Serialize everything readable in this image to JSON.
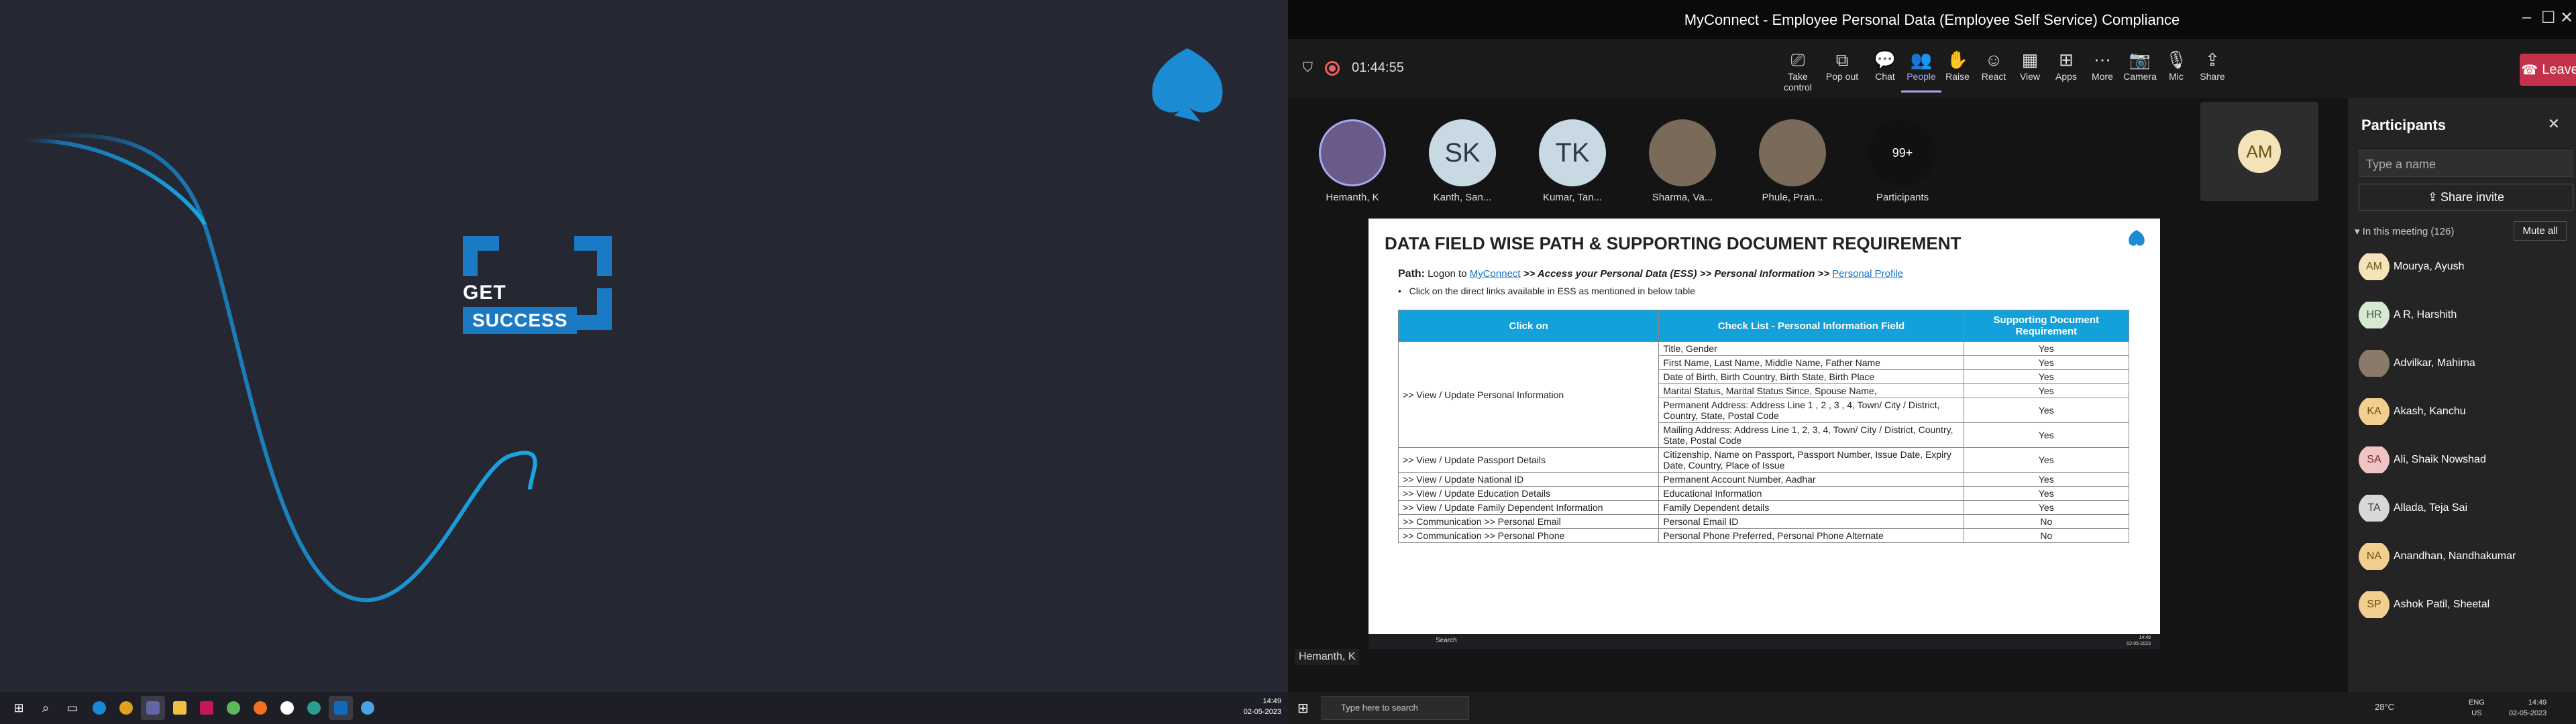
{
  "left_screen": {
    "branding": {
      "get": "GET",
      "success": "SUCCESS"
    },
    "taskbar": {
      "icons": [
        "windows-icon",
        "search-icon",
        "task-view-icon",
        "edge-icon",
        "chrome-icon",
        "teams-icon",
        "explorer-icon",
        "intellij-icon",
        "app-icon",
        "app-icon",
        "app-icon",
        "app-icon",
        "outlook-icon",
        "app-icon"
      ],
      "time": "14:49",
      "date": "02-05-2023"
    }
  },
  "teams": {
    "window_title": "MyConnect - Employee Personal Data (Employee Self Service) Compliance",
    "timer": "01:44:55",
    "toolbar": [
      {
        "icon": "take-control-icon",
        "label": "Take control"
      },
      {
        "icon": "pop-out-icon",
        "label": "Pop out"
      },
      {
        "icon": "chat-icon",
        "label": "Chat"
      },
      {
        "icon": "people-icon",
        "label": "People"
      },
      {
        "icon": "raise-hand-icon",
        "label": "Raise"
      },
      {
        "icon": "react-icon",
        "label": "React"
      },
      {
        "icon": "view-icon",
        "label": "View"
      },
      {
        "icon": "apps-icon",
        "label": "Apps"
      },
      {
        "icon": "more-icon",
        "label": "More"
      },
      {
        "icon": "camera-icon",
        "label": "Camera"
      },
      {
        "icon": "mic-icon",
        "label": "Mic"
      },
      {
        "icon": "share-icon",
        "label": "Share"
      }
    ],
    "leave_label": "Leave",
    "participants_strip": [
      {
        "initials": "",
        "name": "Hemanth, K",
        "photo": true
      },
      {
        "initials": "SK",
        "name": "Kanth, San..."
      },
      {
        "initials": "TK",
        "name": "Kumar, Tan..."
      },
      {
        "initials": "",
        "name": "Sharma, Va...",
        "photo": true
      },
      {
        "initials": "",
        "name": "Phule, Pran...",
        "photo": true
      },
      {
        "initials": "99+",
        "name": "Participants"
      }
    ],
    "am_tile": "AM",
    "sharer_name": "Hemanth, K",
    "document": {
      "title": "DATA FIELD WISE PATH & SUPPORTING DOCUMENT REQUIREMENT",
      "path_label": "Path:",
      "path_text": "Logon to",
      "path_link1": "MyConnect",
      "path_mid": ">> Access your Personal Data (ESS) >> Personal Information >>",
      "path_link2": "Personal Profile",
      "bullet": "Click on the direct links available in ESS as mentioned in below table",
      "headers": [
        "Click on",
        "Check List - Personal Information Field",
        "Supporting Document Requirement"
      ],
      "rows": [
        {
          "click": ">> View / Update Personal Information",
          "span": 6,
          "fields": [
            [
              "Title, Gender",
              "Yes"
            ],
            [
              "First Name, Last Name, Middle Name, Father Name",
              "Yes"
            ],
            [
              "Date of Birth, Birth Country, Birth State, Birth Place",
              "Yes"
            ],
            [
              "Marital Status, Marital Status Since, Spouse Name,",
              "Yes"
            ],
            [
              "Permanent Address: Address Line 1 , 2 , 3 , 4, Town/ City / District, Country, State, Postal Code",
              "Yes"
            ],
            [
              "Mailing Address: Address Line 1, 2, 3, 4, Town/ City / District, Country, State, Postal Code",
              "Yes"
            ]
          ]
        },
        {
          "click": ">> View / Update Passport Details",
          "span": 1,
          "fields": [
            [
              "Citizenship, Name on Passport, Passport Number, Issue Date, Expiry Date, Country, Place of Issue",
              "Yes"
            ]
          ]
        },
        {
          "click": ">> View / Update National ID",
          "span": 1,
          "fields": [
            [
              "Permanent Account Number, Aadhar",
              "Yes"
            ]
          ]
        },
        {
          "click": ">> View / Update Education Details",
          "span": 1,
          "fields": [
            [
              "Educational Information",
              "Yes"
            ]
          ]
        },
        {
          "click": ">> View / Update Family Dependent Information",
          "span": 1,
          "fields": [
            [
              "Family Dependent details",
              "Yes"
            ]
          ]
        },
        {
          "click": ">> Communication >> Personal Email",
          "span": 1,
          "fields": [
            [
              "Personal Email ID",
              "No"
            ]
          ]
        },
        {
          "click": ">> Communication >> Personal Phone",
          "span": 1,
          "fields": [
            [
              "Personal Phone Preferred, Personal Phone Alternate",
              "No"
            ]
          ]
        }
      ],
      "mini_taskbar": {
        "search": "Search",
        "time": "14:49",
        "date": "02-05-2023"
      }
    },
    "panel": {
      "title": "Participants",
      "search_placeholder": "Type a name",
      "share_invite": "Share invite",
      "in_meeting": "In this meeting (126)",
      "mute_all": "Mute all",
      "people": [
        {
          "initials": "AM",
          "name": "Mourya, Ayush",
          "color": "#f4e2b8",
          "fg": "#6b5313"
        },
        {
          "initials": "HR",
          "name": "A R, Harshith",
          "color": "#d7e9d3",
          "fg": "#3b5d33"
        },
        {
          "initials": "",
          "name": "Advilkar, Mahima",
          "color": "#8a7a6a",
          "fg": "#fff"
        },
        {
          "initials": "KA",
          "name": "Akash, Kanchu",
          "color": "#f2cf8e",
          "fg": "#6b4f13"
        },
        {
          "initials": "SA",
          "name": "Ali, Shaik Nowshad",
          "color": "#f0c4c4",
          "fg": "#7a2a2a"
        },
        {
          "initials": "TA",
          "name": "Allada, Teja Sai",
          "color": "#d8d8d8",
          "fg": "#444"
        },
        {
          "initials": "NA",
          "name": "Anandhan, Nandhakumar",
          "color": "#f2cf8e",
          "fg": "#6b4f13"
        },
        {
          "initials": "SP",
          "name": "Ashok Patil, Sheetal",
          "color": "#f2cf8e",
          "fg": "#6b4f13"
        }
      ]
    }
  },
  "right_taskbar": {
    "search_placeholder": "Type here to search",
    "weather": "28°C",
    "lang": "ENG",
    "region": "US",
    "time": "14:49",
    "date": "02-05-2023"
  }
}
